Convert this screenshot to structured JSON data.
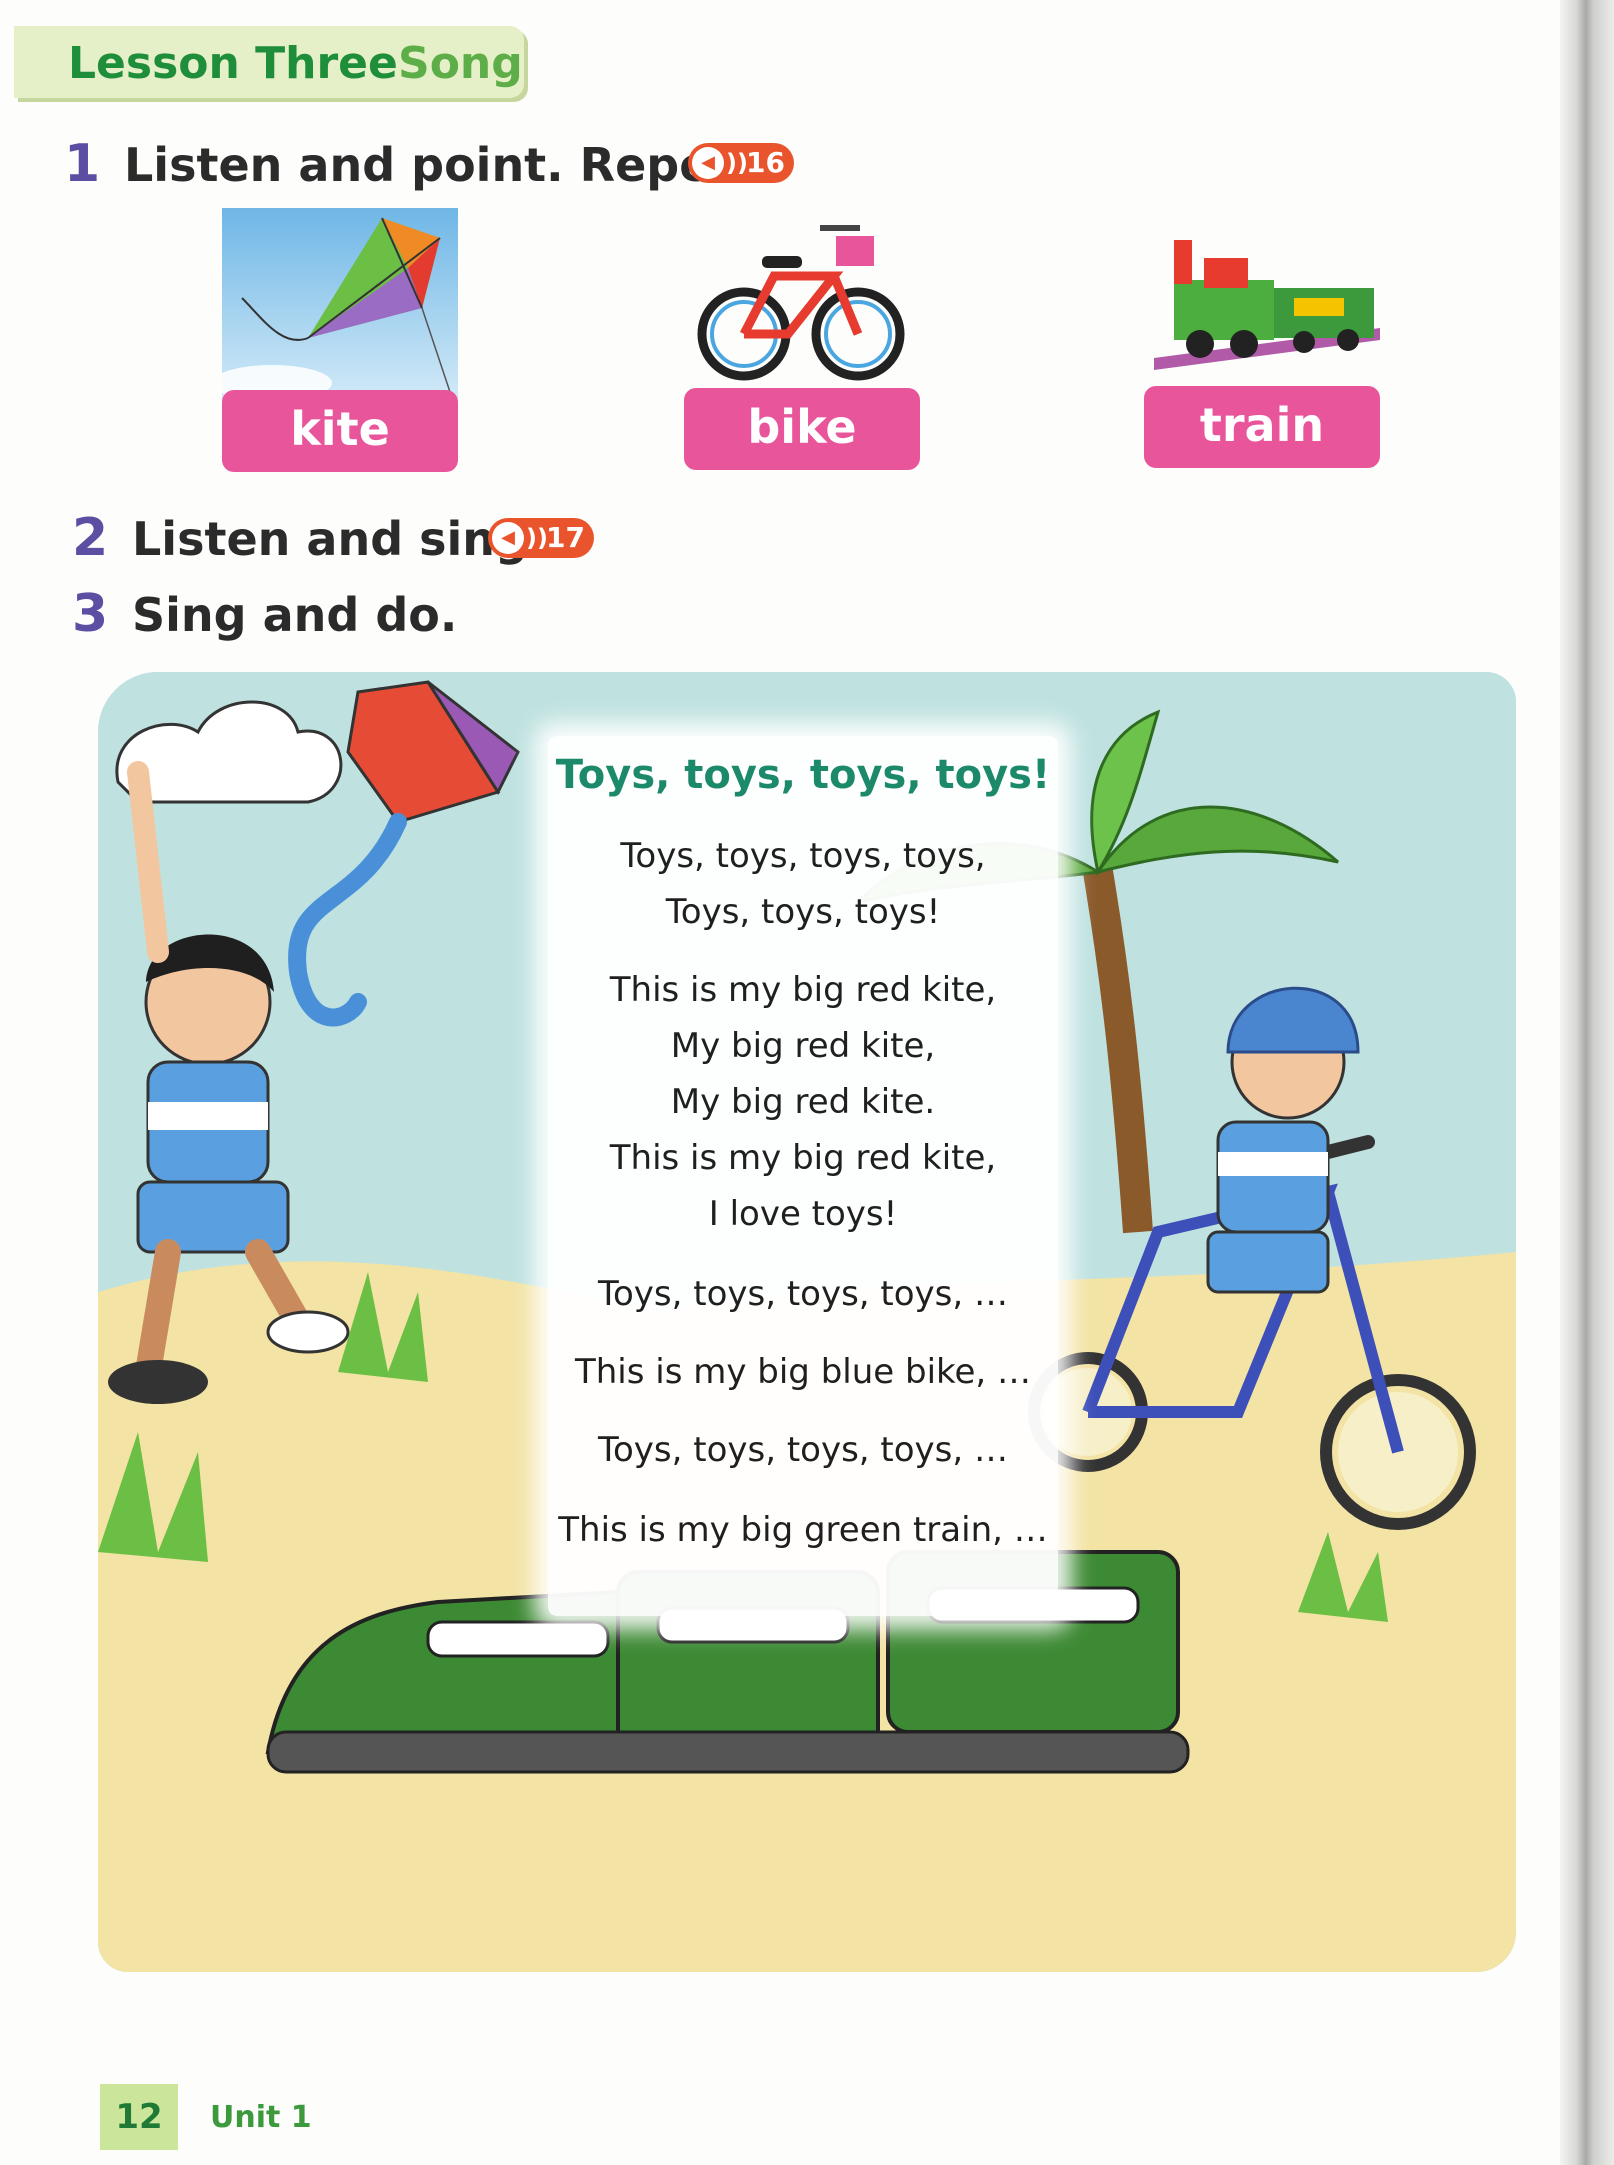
{
  "header": {
    "lesson": "Lesson Three",
    "type": "Song"
  },
  "exercises": [
    {
      "number": "1",
      "text": "Listen and point. Repeat.",
      "audio": "16"
    },
    {
      "number": "2",
      "text": "Listen and sing.",
      "audio": "17"
    },
    {
      "number": "3",
      "text": "Sing and do."
    }
  ],
  "vocab": [
    "kite",
    "bike",
    "train"
  ],
  "song": {
    "title": "Toys, toys, toys, toys!",
    "lines": [
      "Toys, toys, toys, toys,",
      "Toys, toys, toys!",
      "This is my big red kite,",
      "My big red kite,",
      "My big red kite.",
      "This is my big red kite,",
      "I love toys!",
      "Toys, toys, toys, toys, …",
      "This is my big blue bike, …",
      "Toys, toys, toys, toys, …",
      "This is my big green train, …"
    ]
  },
  "footer": {
    "page": "12",
    "unit": "Unit 1"
  },
  "colors": {
    "accent_green": "#1f8e3a",
    "label_pink": "#e8559b",
    "audio_orange": "#e9542c",
    "number_purple": "#5b4ea3",
    "title_teal": "#1c8a6a"
  }
}
